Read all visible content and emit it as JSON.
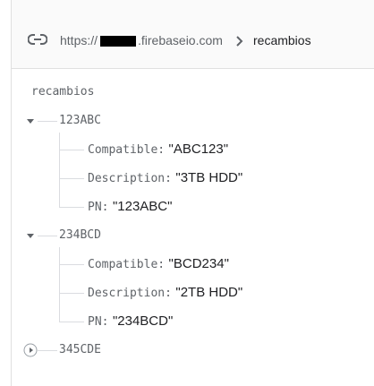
{
  "url": {
    "prefix": "https://",
    "domain": ".firebaseio.com",
    "path": "recambios"
  },
  "root": "recambios",
  "nodes": [
    {
      "key": "123ABC",
      "expanded": true,
      "fields": [
        {
          "key": "Compatible:",
          "value": "\"ABC123\""
        },
        {
          "key": "Description:",
          "value": "\"3TB HDD\""
        },
        {
          "key": "PN:",
          "value": "\"123ABC\""
        }
      ]
    },
    {
      "key": "234BCD",
      "expanded": true,
      "fields": [
        {
          "key": "Compatible:",
          "value": "\"BCD234\""
        },
        {
          "key": "Description:",
          "value": "\"2TB HDD\""
        },
        {
          "key": "PN:",
          "value": "\"234BCD\""
        }
      ]
    },
    {
      "key": "345CDE",
      "expanded": false,
      "fields": []
    }
  ],
  "icons": {
    "link": "link-icon",
    "chevron": "chevron-right-icon",
    "expanded": "caret-down-icon",
    "collapsed": "play-circle-icon"
  },
  "colors": {
    "text_primary": "#202124",
    "text_secondary": "#5f6368",
    "tree_line": "#dadce0",
    "border": "#e0e0e0"
  }
}
